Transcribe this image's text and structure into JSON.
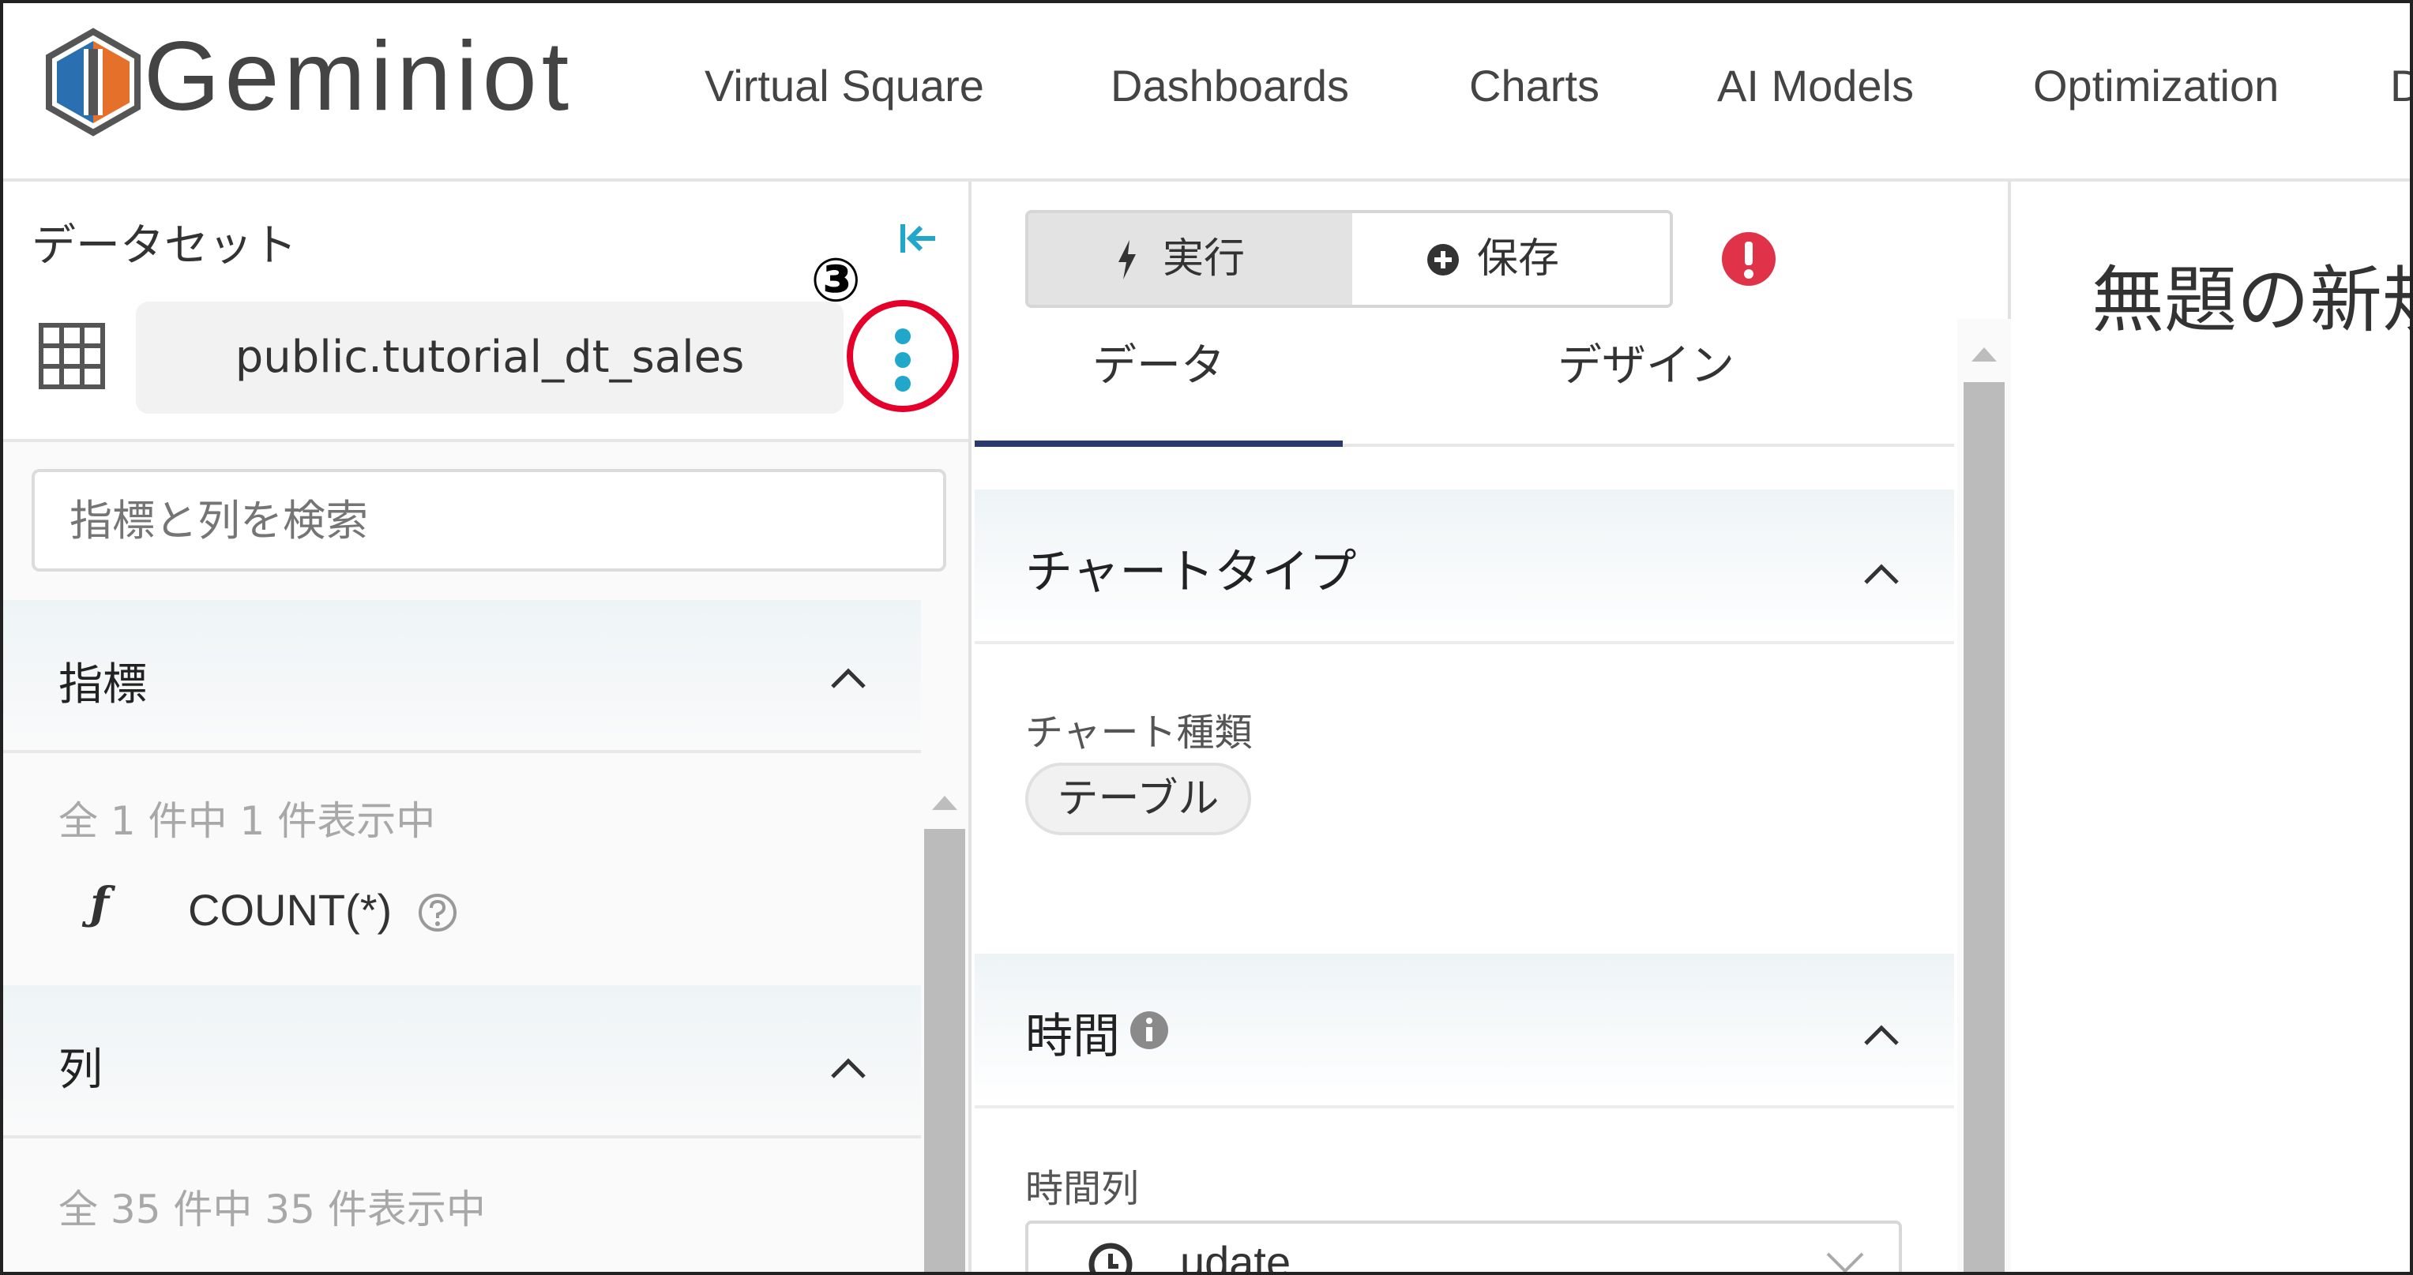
{
  "app": {
    "nav": [
      "Virtual Square",
      "Dashboards",
      "Charts",
      "AI Models",
      "Optimization",
      "D"
    ]
  },
  "colors": {
    "accent": "#20a7c9",
    "annotation_red": "#e4002b",
    "logo_orange": "#e5702a",
    "logo_blue": "#2a6fb0",
    "tab_underline": "#2b3a6b",
    "alert_red": "#e0334a"
  },
  "left_panel": {
    "dataset_label": "データセット",
    "collapse_icon": "collapse-left-icon",
    "annotation_number": "③",
    "dataset_name": "public.tutorial_dt_sales",
    "search_placeholder": "指標と列を検索",
    "metrics": {
      "title": "指標",
      "count_text": "全 1 件中 1 件表示中",
      "items": [
        {
          "icon": "ƒ",
          "name": "COUNT(*)"
        }
      ]
    },
    "columns": {
      "title": "列",
      "count_text": "全 35 件中 35 件表示中"
    }
  },
  "toolbar": {
    "run_label": "実行",
    "save_label": "保存"
  },
  "tabs": [
    "データ",
    "デザイン"
  ],
  "sections": {
    "chart_type": {
      "title": "チャートタイプ",
      "field_label": "チャート種類",
      "value": "テーブル"
    },
    "time": {
      "title": "時間",
      "field_label": "時間列",
      "value": "udate"
    }
  },
  "right_panel": {
    "title": "無題の新規"
  }
}
